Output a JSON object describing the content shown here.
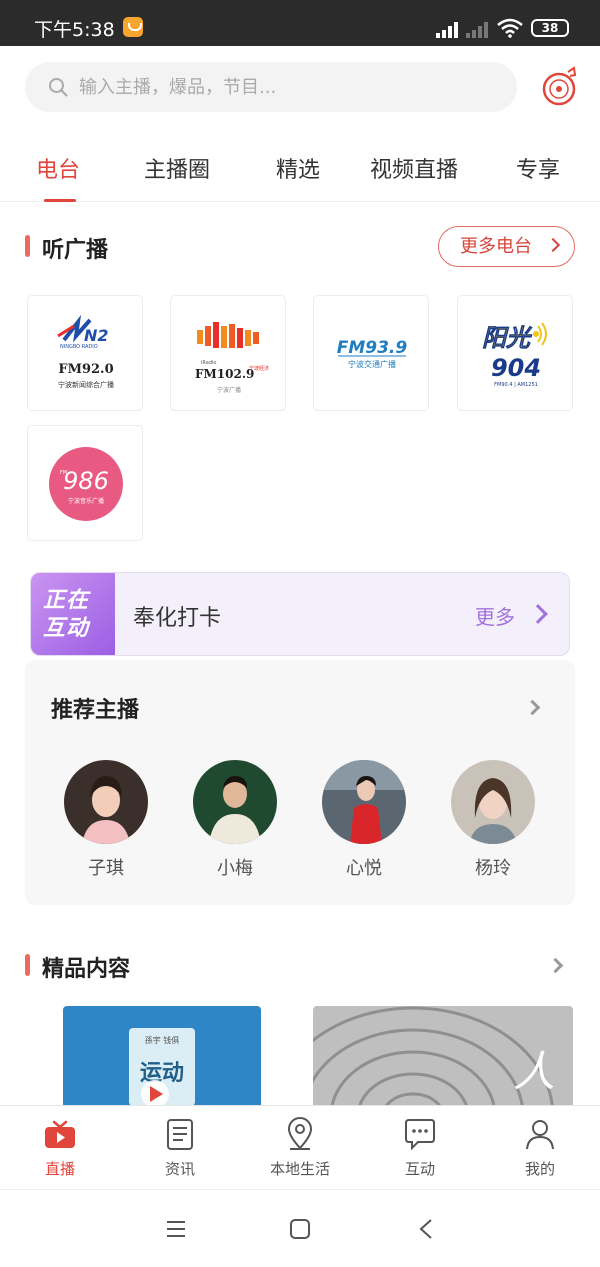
{
  "status_bar": {
    "time": "下午5:38",
    "battery": "38"
  },
  "search": {
    "placeholder": "输入主播，爆品，节目..."
  },
  "tabs": [
    {
      "label": "电台",
      "active": true
    },
    {
      "label": "主播圈"
    },
    {
      "label": "精选"
    },
    {
      "label": "视频直播"
    },
    {
      "label": "专享"
    }
  ],
  "radio_section": {
    "title": "听广播",
    "more_label": "更多电台",
    "stations": [
      {
        "freq": "FM92.0",
        "name": "宁波新闻综合广播",
        "logo_text": "N2",
        "logo_sub": "NINGBO RADIO"
      },
      {
        "freq": "FM102.9",
        "name": "宁波广播",
        "logo_text": "iRadio",
        "logo_sub": "宁波经济"
      },
      {
        "freq": "FM93.9",
        "name": "宁波交通广播"
      },
      {
        "freq": "904",
        "name": "阳光",
        "logo_sub": "FM90.4 | AM1251"
      },
      {
        "freq": "986",
        "name": "宁波音乐广播",
        "logo_text": "FM"
      }
    ]
  },
  "interactive_banner": {
    "badge_line1": "正在",
    "badge_line2": "互动",
    "title": "奉化打卡",
    "more_label": "更多"
  },
  "hosts_section": {
    "title": "推荐主播",
    "hosts": [
      {
        "name": "子琪"
      },
      {
        "name": "小梅"
      },
      {
        "name": "心悦"
      },
      {
        "name": "杨玲"
      }
    ]
  },
  "featured_section": {
    "title": "精品内容",
    "items": [
      {
        "image_text": "运动",
        "image_small_text": "孫宇 钱俱"
      },
      {
        "image_text": "人"
      }
    ]
  },
  "bottom_nav": [
    {
      "label": "直播",
      "icon": "tv-icon",
      "active": true
    },
    {
      "label": "资讯",
      "icon": "news-icon"
    },
    {
      "label": "本地生活",
      "icon": "location-icon"
    },
    {
      "label": "互动",
      "icon": "chat-icon"
    },
    {
      "label": "我的",
      "icon": "profile-icon"
    }
  ],
  "colors": {
    "accent": "#e0463b",
    "banner_purple": "#a171de"
  }
}
